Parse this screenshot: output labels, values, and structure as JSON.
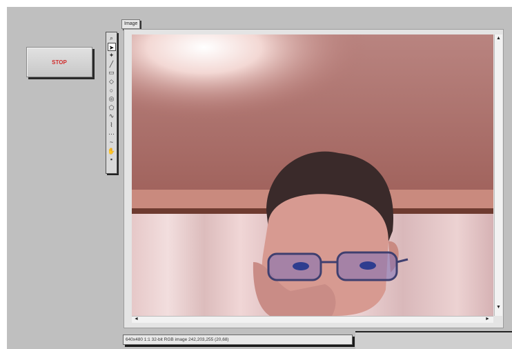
{
  "stop_button": {
    "label": "STOP"
  },
  "image_display": {
    "label": "Image"
  },
  "status_bar": {
    "text": "640x480 1:1 32-bit RGB image 242,203,255    (20,68)"
  },
  "tools": [
    {
      "name": "zoom-tool-icon",
      "glyph": "⌕"
    },
    {
      "name": "pointer-tool-icon",
      "glyph": "➤",
      "selected": true
    },
    {
      "name": "point-tool-icon",
      "glyph": "✦"
    },
    {
      "name": "line-tool-icon",
      "glyph": "╱"
    },
    {
      "name": "rectangle-tool-icon",
      "glyph": "▭"
    },
    {
      "name": "rotated-rectangle-tool-icon",
      "glyph": "◇"
    },
    {
      "name": "oval-tool-icon",
      "glyph": "○"
    },
    {
      "name": "annulus-tool-icon",
      "glyph": "◎"
    },
    {
      "name": "polygon-tool-icon",
      "glyph": "⬠"
    },
    {
      "name": "freehand-tool-icon",
      "glyph": "∿"
    },
    {
      "name": "polyline-tool-icon",
      "glyph": "⌇"
    },
    {
      "name": "broken-line-tool-icon",
      "glyph": "⋯"
    },
    {
      "name": "freehand-line-tool-icon",
      "glyph": "~"
    },
    {
      "name": "pan-tool-icon",
      "glyph": "✋"
    },
    {
      "name": "palette-end-icon",
      "glyph": "▪"
    }
  ]
}
